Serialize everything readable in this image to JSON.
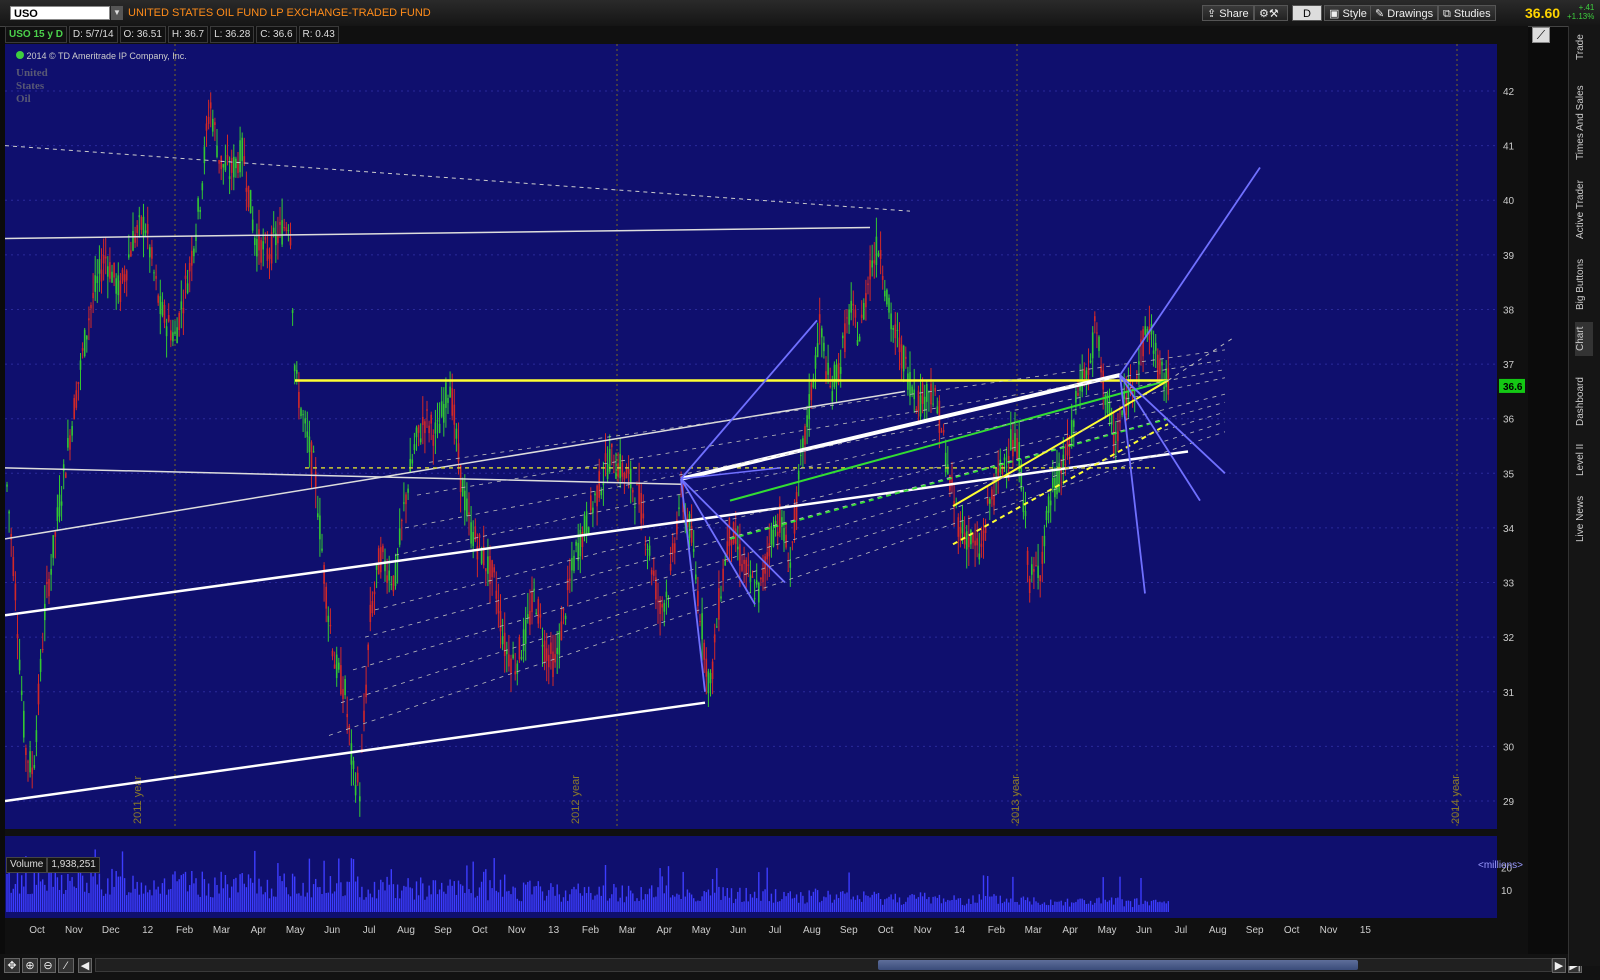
{
  "topbar": {
    "symbol": "USO",
    "title": "UNITED STATES OIL FUND LP EXCHANGE-TRADED FUND",
    "buttons": {
      "share": "Share",
      "timeframe": "D",
      "style": "Style",
      "drawings": "Drawings",
      "studies": "Studies"
    },
    "last_price": "36.60",
    "net_change": "+.41",
    "pct_change": "+1.13%"
  },
  "info_bar": {
    "symbol_period": "USO 15 y D",
    "date": "D: 5/7/14",
    "open": "O: 36.51",
    "high": "H: 36.7",
    "low": "L: 36.28",
    "close": "C: 36.6",
    "range": "R: 0.43"
  },
  "watermark": {
    "copyright": "2014 © TD Ameritrade IP Company, Inc.",
    "logo_lines": [
      "United",
      "States",
      "Oil"
    ]
  },
  "price_axis": {
    "ticks": [
      "42",
      "41",
      "40",
      "39",
      "38",
      "37",
      "36",
      "35",
      "34",
      "33",
      "32",
      "31",
      "30",
      "29"
    ],
    "last_price_label": "36.6"
  },
  "year_labels": [
    "2011 year",
    "2012 year",
    "2013 year",
    "2014 year"
  ],
  "volume": {
    "label": "Volume",
    "value": "1,938,251",
    "units": "<millions>",
    "ticks": [
      "20",
      "10"
    ]
  },
  "time_axis": {
    "labels": [
      "Oct",
      "Nov",
      "Dec",
      "12",
      "Feb",
      "Mar",
      "Apr",
      "May",
      "Jun",
      "Jul",
      "Aug",
      "Sep",
      "Oct",
      "Nov",
      "13",
      "Feb",
      "Mar",
      "Apr",
      "May",
      "Jun",
      "Jul",
      "Aug",
      "Sep",
      "Oct",
      "Nov",
      "14",
      "Feb",
      "Mar",
      "Apr",
      "May",
      "Jun",
      "Jul",
      "Aug",
      "Sep",
      "Oct",
      "Nov",
      "15"
    ]
  },
  "right_rail": {
    "tabs": [
      "Trade",
      "Times And Sales",
      "Active Trader",
      "Big Buttons",
      "Chart",
      "Dashboard",
      "Level II",
      "Live News"
    ],
    "active_tab": "Chart"
  },
  "chart_data": {
    "type": "candlestick",
    "instrument": "USO",
    "y_range": [
      28.7,
      42.7
    ],
    "colors": {
      "background": "#0f0f6e",
      "up": "#32c832",
      "down": "#d22828",
      "grid": "#6a5a1a",
      "price_line": "#ffff33"
    },
    "price_path": [
      [
        0,
        35.2
      ],
      [
        10,
        33.0
      ],
      [
        20,
        30.0
      ],
      [
        28,
        29.5
      ],
      [
        40,
        32.5
      ],
      [
        55,
        34.5
      ],
      [
        70,
        36.3
      ],
      [
        85,
        38.0
      ],
      [
        100,
        39.0
      ],
      [
        115,
        38.3
      ],
      [
        128,
        39.3
      ],
      [
        140,
        39.6
      ],
      [
        155,
        38.0
      ],
      [
        170,
        37.5
      ],
      [
        185,
        38.8
      ],
      [
        195,
        40.0
      ],
      [
        205,
        41.8
      ],
      [
        215,
        40.7
      ],
      [
        225,
        40.5
      ],
      [
        238,
        40.9
      ],
      [
        250,
        39.3
      ],
      [
        262,
        39.0
      ],
      [
        275,
        39.4
      ],
      [
        285,
        39.7
      ],
      [
        290,
        36.8
      ],
      [
        300,
        35.8
      ],
      [
        310,
        35.0
      ],
      [
        320,
        33.0
      ],
      [
        330,
        31.5
      ],
      [
        340,
        31.0
      ],
      [
        348,
        29.5
      ],
      [
        355,
        29.2
      ],
      [
        365,
        32.3
      ],
      [
        375,
        33.5
      ],
      [
        390,
        33.0
      ],
      [
        400,
        34.5
      ],
      [
        410,
        35.5
      ],
      [
        420,
        36.0
      ],
      [
        432,
        35.7
      ],
      [
        445,
        36.7
      ],
      [
        455,
        35.0
      ],
      [
        465,
        34.0
      ],
      [
        478,
        33.5
      ],
      [
        490,
        33.0
      ],
      [
        500,
        31.8
      ],
      [
        510,
        31.5
      ],
      [
        520,
        32.0
      ],
      [
        530,
        32.8
      ],
      [
        540,
        31.8
      ],
      [
        550,
        31.5
      ],
      [
        560,
        32.5
      ],
      [
        570,
        33.5
      ],
      [
        580,
        34.0
      ],
      [
        595,
        34.8
      ],
      [
        605,
        35.3
      ],
      [
        620,
        35.0
      ],
      [
        635,
        34.5
      ],
      [
        645,
        33.5
      ],
      [
        655,
        32.5
      ],
      [
        665,
        33.0
      ],
      [
        675,
        34.6
      ],
      [
        685,
        34.0
      ],
      [
        695,
        32.5
      ],
      [
        705,
        31.0
      ],
      [
        715,
        32.8
      ],
      [
        725,
        34.0
      ],
      [
        735,
        33.5
      ],
      [
        745,
        33.0
      ],
      [
        755,
        32.8
      ],
      [
        765,
        33.8
      ],
      [
        775,
        34.2
      ],
      [
        785,
        33.3
      ],
      [
        795,
        35.0
      ],
      [
        805,
        36.3
      ],
      [
        815,
        37.7
      ],
      [
        825,
        36.5
      ],
      [
        835,
        37.0
      ],
      [
        845,
        38.0
      ],
      [
        855,
        37.5
      ],
      [
        865,
        38.8
      ],
      [
        875,
        39.2
      ],
      [
        885,
        37.8
      ],
      [
        895,
        37.3
      ],
      [
        905,
        36.7
      ],
      [
        915,
        36.3
      ],
      [
        925,
        36.6
      ],
      [
        935,
        36.0
      ],
      [
        945,
        34.8
      ],
      [
        955,
        34.0
      ],
      [
        965,
        33.8
      ],
      [
        975,
        33.5
      ],
      [
        985,
        34.5
      ],
      [
        995,
        35.0
      ],
      [
        1005,
        35.6
      ],
      [
        1015,
        35.3
      ],
      [
        1025,
        33.0
      ],
      [
        1035,
        33.3
      ],
      [
        1045,
        34.5
      ],
      [
        1055,
        35.0
      ],
      [
        1065,
        35.5
      ],
      [
        1075,
        36.7
      ],
      [
        1085,
        36.9
      ],
      [
        1090,
        37.7
      ],
      [
        1100,
        36.5
      ],
      [
        1110,
        35.5
      ],
      [
        1120,
        36.3
      ],
      [
        1130,
        36.8
      ],
      [
        1140,
        37.5
      ],
      [
        1145,
        37.7
      ],
      [
        1155,
        36.8
      ],
      [
        1165,
        36.6
      ]
    ],
    "volume_profile": "declining"
  }
}
